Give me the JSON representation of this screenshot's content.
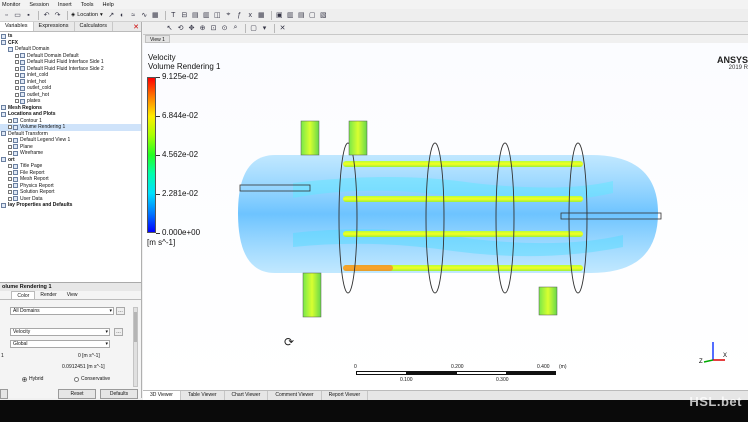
{
  "menu": [
    "Monitor",
    "Session",
    "Insert",
    "Tools",
    "Help"
  ],
  "toolbar": {
    "location_label": "Location"
  },
  "left_tabs": [
    "Variables",
    "Expressions",
    "Calculators"
  ],
  "tree": [
    {
      "label": "ts",
      "level": 0,
      "bold": true
    },
    {
      "label": "CFX",
      "level": 0,
      "bold": true
    },
    {
      "label": "Default Domain",
      "level": 1
    },
    {
      "label": "Default Domain Default",
      "level": 2,
      "check": true
    },
    {
      "label": "Default Fluid Fluid Interface Side 1",
      "level": 2,
      "check": true
    },
    {
      "label": "Default Fluid Fluid Interface Side 2",
      "level": 2,
      "check": true
    },
    {
      "label": "inlet_cold",
      "level": 2,
      "check": true
    },
    {
      "label": "inlet_hot",
      "level": 2,
      "check": true
    },
    {
      "label": "outlet_cold",
      "level": 2,
      "check": true
    },
    {
      "label": "outlet_hot",
      "level": 2,
      "check": true
    },
    {
      "label": "plates",
      "level": 2,
      "check": true
    },
    {
      "label": "Mesh Regions",
      "level": 0,
      "bold": true
    },
    {
      "label": "Locations and Plots",
      "level": 0,
      "bold": true
    },
    {
      "label": "Contour 1",
      "level": 1,
      "check": true
    },
    {
      "label": "Volume Rendering 1",
      "level": 1,
      "check": true,
      "selected": true
    },
    {
      "label": "Default Transform",
      "level": 0
    },
    {
      "label": "Default Legend View 1",
      "level": 1,
      "check": true
    },
    {
      "label": "Plane",
      "level": 1,
      "check": true
    },
    {
      "label": "Wireframe",
      "level": 1,
      "check": true
    },
    {
      "label": "ort",
      "level": 0,
      "bold": true
    },
    {
      "label": "Title Page",
      "level": 1,
      "check": true
    },
    {
      "label": "File Report",
      "level": 1,
      "check": true
    },
    {
      "label": "Mesh Report",
      "level": 1,
      "check": true
    },
    {
      "label": "Physics Report",
      "level": 1,
      "check": true
    },
    {
      "label": "Solution Report",
      "level": 1,
      "check": true
    },
    {
      "label": "User Data",
      "level": 1,
      "check": true
    },
    {
      "label": "lay Properties and Defaults",
      "level": 0,
      "bold": true
    }
  ],
  "details": {
    "title": "olume Rendering 1",
    "tabs": [
      "Color",
      "Render",
      "View"
    ],
    "domains": "All Domains",
    "variable": "Velocity",
    "range": "Global",
    "min_value": "0 [m s^-1]",
    "max_value": "0.0912451 [m s^-1]",
    "min_label": "1",
    "radio_hybrid": "Hybrid",
    "radio_conservative": "Conservative",
    "reset_label": "Reset",
    "defaults_label": "Defaults"
  },
  "view_tab": "View 1",
  "legend": {
    "title": "Velocity",
    "subtitle": "Volume Rendering 1",
    "labels": [
      "9.125e-02",
      "6.844e-02",
      "4.562e-02",
      "2.281e-02",
      "0.000e+00"
    ],
    "unit": "[m s^-1]"
  },
  "logo": {
    "name": "ANSYS",
    "version": "2019 R"
  },
  "scale": {
    "ticks": [
      "0",
      "0.100",
      "0.200",
      "0.300",
      "0.400"
    ],
    "unit": "(m)"
  },
  "axis": {
    "z": "Z",
    "x": "X"
  },
  "bottom_tabs": [
    "3D Viewer",
    "Table Viewer",
    "Chart Viewer",
    "Comment Viewer",
    "Report Viewer"
  ],
  "watermark": "HSL.bet",
  "colors": {
    "accent": "#cfe3fa",
    "fluid": "#4ec3ff",
    "hot": "#ffee00"
  }
}
